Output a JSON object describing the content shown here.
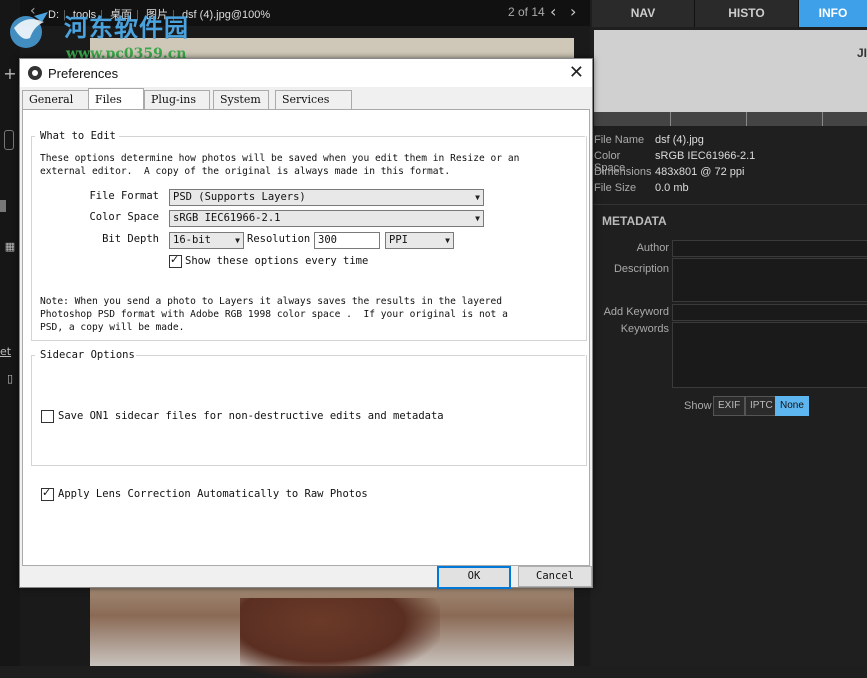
{
  "breadcrumb": {
    "items": [
      "D:",
      "tools",
      "桌面",
      "图片"
    ],
    "file": "dsf (4).jpg@100%",
    "counter": "2 of 14"
  },
  "watermark": {
    "site_name": "河东软件园",
    "url": "www.pc0359.cn"
  },
  "right_panel": {
    "tabs": [
      {
        "label": "NAV",
        "active": false
      },
      {
        "label": "HISTO",
        "active": false
      },
      {
        "label": "INFO",
        "active": true
      }
    ],
    "histo_label": "JI",
    "file_info": [
      {
        "key": "File Name",
        "value": "dsf (4).jpg"
      },
      {
        "key": "Color Space",
        "value": "sRGB IEC61966-2.1"
      },
      {
        "key": "Dimensions",
        "value": "483x801 @ 72 ppi"
      },
      {
        "key": "File Size",
        "value": "0.0 mb"
      }
    ],
    "metadata_title": "METADATA",
    "metadata_fields": [
      "Author",
      "Description",
      "Add Keyword",
      "Keywords"
    ],
    "show_label": "Show",
    "show_buttons": [
      {
        "label": "EXIF",
        "active": false
      },
      {
        "label": "IPTC",
        "active": false
      },
      {
        "label": "None",
        "active": true
      }
    ]
  },
  "left_rail": {
    "link_text": "et"
  },
  "dialog": {
    "title": "Preferences",
    "tabs": [
      {
        "label": "General",
        "active": false
      },
      {
        "label": "Files",
        "active": true
      },
      {
        "label": "Plug-ins",
        "active": false
      },
      {
        "label": "System",
        "active": false
      },
      {
        "label": "Services",
        "active": false
      }
    ],
    "what_to_edit": {
      "title": "What to Edit",
      "description": "These options determine how photos will be saved when you edit them in Resize or an\nexternal editor.  A copy of the original is always made in this format.",
      "file_format_label": "File Format",
      "file_format_value": "PSD (Supports Layers)",
      "color_space_label": "Color Space",
      "color_space_value": "sRGB IEC61966-2.1",
      "bit_depth_label": "Bit Depth",
      "bit_depth_value": "16-bit",
      "resolution_label": "Resolution",
      "resolution_value": "300",
      "resolution_unit": "PPI",
      "show_options_label": "Show these options every time",
      "show_options_checked": true,
      "note": "Note: When you send a photo to Layers it always saves the results in the layered\nPhotoshop PSD format with Adobe RGB 1998 color space .  If your original is not a\nPSD, a copy will be made."
    },
    "sidecar": {
      "title": "Sidecar Options",
      "save_sidecar_label": "Save ON1 sidecar files for non-destructive edits and metadata",
      "save_sidecar_checked": false
    },
    "lens_correction_label": "Apply Lens Correction Automatically to Raw Photos",
    "lens_correction_checked": true,
    "ok_label": "OK",
    "cancel_label": "Cancel"
  }
}
